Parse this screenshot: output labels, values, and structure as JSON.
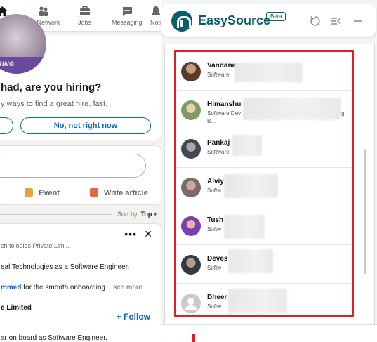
{
  "linkedin": {
    "nav": [
      {
        "label": "ome",
        "icon": "home-icon"
      },
      {
        "label": "My Network",
        "icon": "people-icon"
      },
      {
        "label": "Jobs",
        "icon": "briefcase-icon"
      },
      {
        "label": "Messaging",
        "icon": "message-icon"
      },
      {
        "label": "Noti",
        "icon": "bell-icon"
      }
    ],
    "hiring_badge": "IRING",
    "hire_title": "had, are you hiring?",
    "hire_sub": "y ways to find a great hire, fast.",
    "no_button": "No, not right now",
    "post_actions": [
      {
        "label": "Event",
        "icon": "calendar-icon"
      },
      {
        "label": "Write article",
        "icon": "article-icon"
      }
    ],
    "sort_prefix": "Sort by:",
    "sort_value": "Top",
    "feed": {
      "company_line": "chnologies Private Limi...",
      "text_line": "eal Technologies as a Software Engineer.",
      "link_text": "mmed",
      "after_link": "for the smooth onboarding",
      "see_more": "...see more",
      "company2": "e Limited",
      "follow": "+ Follow",
      "bottom_line": "ar on board as Software Engineer."
    }
  },
  "easysource": {
    "title": "EasySource",
    "beta": "Beta",
    "candidates": [
      {
        "name": "Vandana",
        "subtitle": "Software",
        "avatar": "photo"
      },
      {
        "name": "Himanshu",
        "subtitle": "Software Dev",
        "subtitle_extra": "g",
        "subtitle2": "B...",
        "avatar": "photo"
      },
      {
        "name": "Pankaj",
        "subtitle": "Software",
        "avatar": "photo"
      },
      {
        "name": "Alviy",
        "subtitle": "Softw",
        "avatar": "photo"
      },
      {
        "name": "Tush",
        "subtitle": "Softw",
        "avatar": "photo"
      },
      {
        "name": "Deves",
        "subtitle": "Softw",
        "avatar": "photo"
      },
      {
        "name": "Dheer",
        "subtitle": "Softw",
        "avatar": "default-user-icon"
      }
    ]
  },
  "colors": {
    "linkedin_blue": "#0a66c2",
    "easysource_teal": "#0b5f6b",
    "highlight_red": "#e41e26",
    "hiring_purple": "#6a4a9c"
  }
}
